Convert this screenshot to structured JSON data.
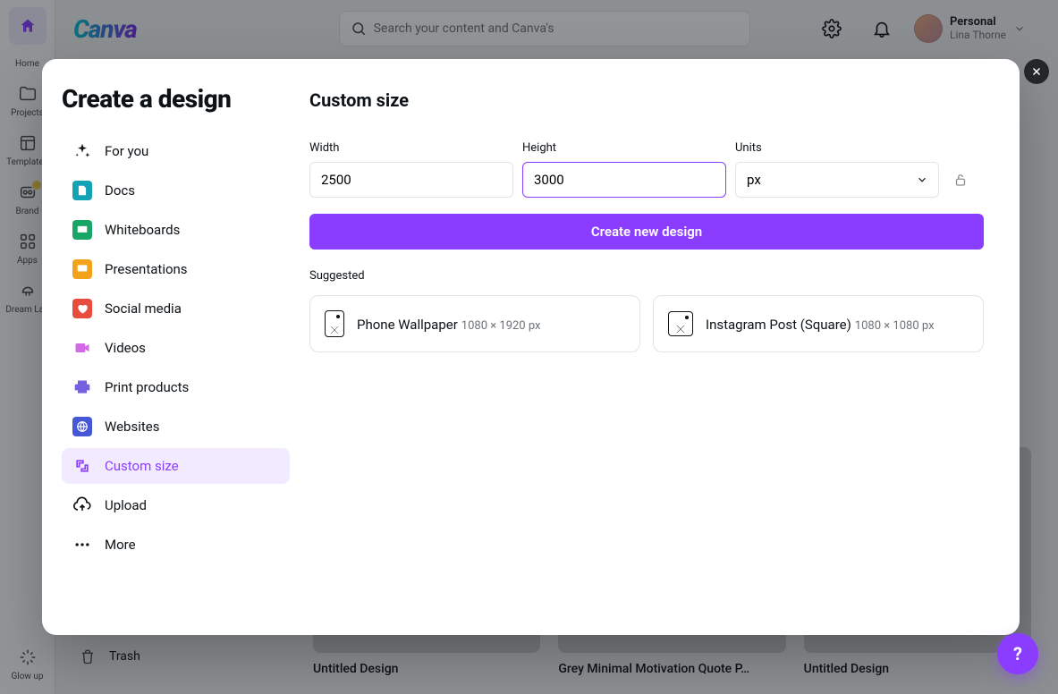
{
  "leftbar": {
    "items": [
      {
        "label": "Home"
      },
      {
        "label": "Projects"
      },
      {
        "label": "Templates"
      },
      {
        "label": "Brand"
      },
      {
        "label": "Apps"
      },
      {
        "label": "Dream Lab"
      },
      {
        "label": "Glow up"
      }
    ]
  },
  "topbar": {
    "logo": "Canva",
    "search_placeholder": "Search your content and Canva's",
    "account_type": "Personal",
    "account_name": "Lina Thorne"
  },
  "secondary_sidebar": {
    "trash": "Trash"
  },
  "recent": [
    {
      "title": "Untitled Design"
    },
    {
      "title": "Grey Minimal Motivation Quote P…"
    },
    {
      "title": "Untitled Design"
    }
  ],
  "modal": {
    "title": "Create a design",
    "nav": [
      {
        "label": "For you"
      },
      {
        "label": "Docs"
      },
      {
        "label": "Whiteboards"
      },
      {
        "label": "Presentations"
      },
      {
        "label": "Social media"
      },
      {
        "label": "Videos"
      },
      {
        "label": "Print products"
      },
      {
        "label": "Websites"
      },
      {
        "label": "Custom size"
      },
      {
        "label": "Upload"
      },
      {
        "label": "More"
      }
    ],
    "section_title": "Custom size",
    "width_label": "Width",
    "height_label": "Height",
    "units_label": "Units",
    "width_value": "2500",
    "height_value": "3000",
    "units_value": "px",
    "create_button": "Create new design",
    "suggested_label": "Suggested",
    "suggested": [
      {
        "name": "Phone Wallpaper",
        "dims": "1080 × 1920 px"
      },
      {
        "name": "Instagram Post (Square)",
        "dims": "1080 × 1080 px"
      }
    ]
  },
  "help": "?"
}
